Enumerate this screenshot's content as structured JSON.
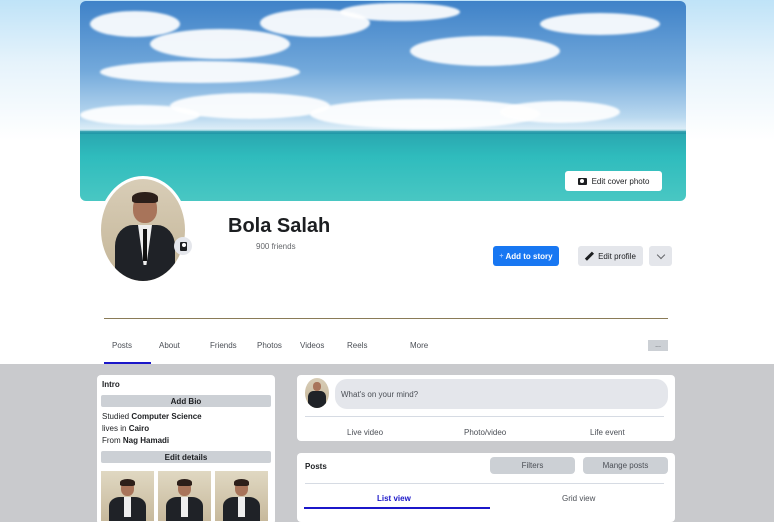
{
  "cover": {
    "edit_label": "Edit cover photo"
  },
  "profile": {
    "name": "Bola Salah",
    "friends": "900 friends"
  },
  "actions": {
    "add_story": "Add to story",
    "edit_profile": "Edit profile"
  },
  "tabs": [
    {
      "label": "Posts",
      "active": true
    },
    {
      "label": "About"
    },
    {
      "label": "Friends"
    },
    {
      "label": "Photos"
    },
    {
      "label": "Videos"
    },
    {
      "label": "Reels"
    },
    {
      "label": "More"
    }
  ],
  "tabs_more_label": "...",
  "intro": {
    "title": "Intro",
    "add_bio": "Add Bio",
    "studied_prefix": "Studied ",
    "studied_value": "Computer Science",
    "lives_prefix": "lives in ",
    "lives_value": "Cairo",
    "from_prefix": "From ",
    "from_value": "Nag Hamadi",
    "edit_details": "Edit details"
  },
  "composer": {
    "placeholder": "What's on your mind?",
    "live_video": "Live video",
    "photo_video": "Photo/video",
    "life_event": "Life event"
  },
  "posts": {
    "title": "Posts",
    "filters": "Filters",
    "manage": "Mange posts",
    "list_view": "List view",
    "grid_view": "Grid view"
  },
  "colors": {
    "primary": "#1877f2",
    "tab_accent": "#1b17c9",
    "grey_area": "#c9cacd"
  }
}
